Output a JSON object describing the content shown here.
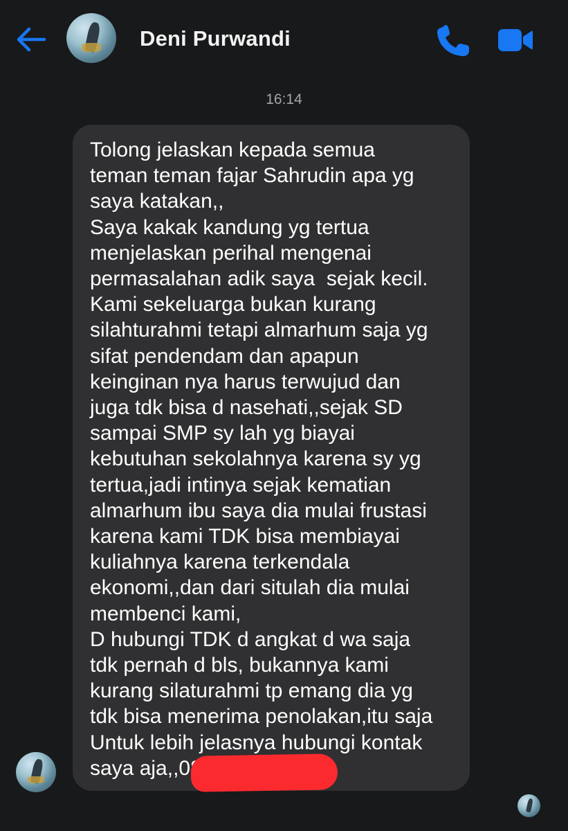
{
  "header": {
    "contact_name": "Deni Purwandi",
    "back_icon": "back-arrow-icon",
    "call_icon": "phone-icon",
    "video_icon": "video-camera-icon",
    "accent_color": "#1877f2"
  },
  "conversation": {
    "timestamp": "16:14",
    "message": {
      "lines": [
        "Tolong jelaskan kepada semua",
        "teman teman fajar Sahrudin apa yg",
        "saya katakan,,",
        "Saya kakak kandung yg tertua",
        "menjelaskan perihal mengenai",
        "permasalahan adik saya  sejak kecil.",
        "Kami sekeluarga bukan kurang",
        "silahturahmi tetapi almarhum saja yg",
        "sifat pendendam dan apapun",
        "keinginan nya harus terwujud dan",
        "juga tdk bisa d nasehati,,sejak SD",
        "sampai SMP sy lah yg biayai",
        "kebutuhan sekolahnya karena sy yg",
        "tertua,jadi intinya sejak kematian",
        "almarhum ibu saya dia mulai frustasi",
        "karena kami TDK bisa membiayai",
        "kuliahnya karena terkendala",
        "ekonomi,,dan dari situlah dia mulai",
        "membenci kami,",
        "D hubungi TDK d angkat d wa saja",
        "tdk pernah d bls, bukannya kami",
        "kurang silaturahmi tp emang dia yg",
        "tdk bisa menerima penolakan,itu saja",
        "Untuk lebih jelasnya hubungi kontak",
        "saya aja,,08"
      ],
      "redaction_color": "#fa2a2e"
    }
  }
}
